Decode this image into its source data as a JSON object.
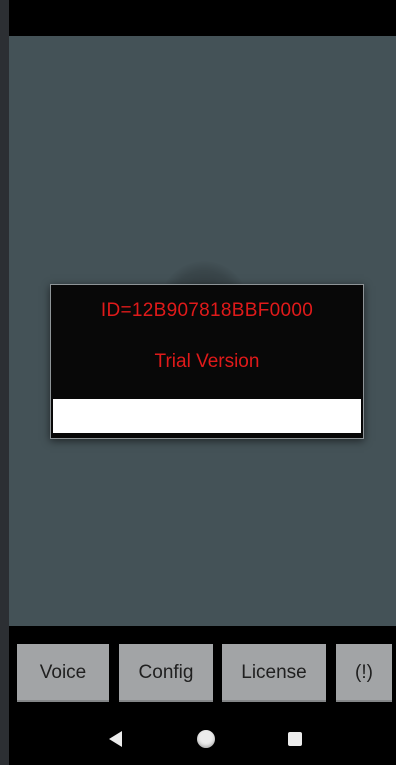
{
  "dialog": {
    "id_text": "ID=12B907818BBF0000",
    "version_text": "Trial Version"
  },
  "buttons": {
    "voice": "Voice",
    "config": "Config",
    "license": "License",
    "warning": "(!)"
  },
  "navigation": {
    "back_icon": "back-triangle",
    "home_icon": "home-circle",
    "recent_icon": "recent-apps-square"
  },
  "colors": {
    "app_background": "#445257",
    "dialog_background": "#080808",
    "dialog_text": "#e01a1a",
    "button_background": "#a2a4a6",
    "bars": "#000000"
  }
}
